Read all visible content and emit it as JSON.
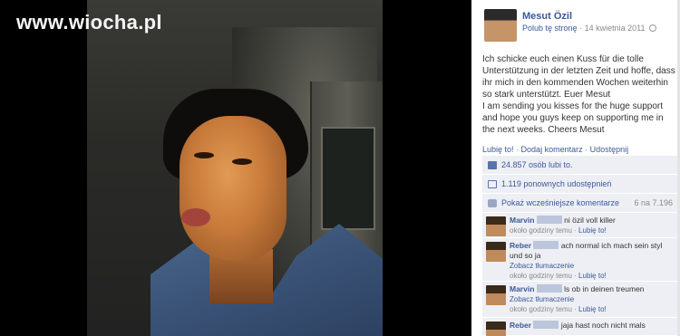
{
  "watermark": "www.wiocha.pl",
  "post": {
    "page_name": "Mesut Özil",
    "like_page": "Polub tę stronę",
    "date": "14 kwietnia 2011",
    "text_de": "Ich schicke euch einen Kuss für die tolle Unterstützung in der letzten Zeit und hoffe, dass ihr mich in den kommenden Wochen weiterhin so stark unterstützt. Euer Mesut",
    "text_en": "I am sending you kisses for the huge support and hope you guys keep on supporting me in the next weeks. Cheers Mesut"
  },
  "actions": {
    "like": "Lubię to!",
    "comment": "Dodaj komentarz",
    "share": "Udostępnij"
  },
  "ufi": {
    "likes": "24.857 osób lubi to.",
    "shares": "1.119 ponownych udostępnień",
    "previous_comments": "Pokaż wcześniejsze komentarze",
    "comment_count": "6 na 7.196"
  },
  "comments": [
    {
      "name": "Marvin",
      "text": "ni özil voll killer",
      "time": "około godziny temu",
      "like": "Lubię to!"
    },
    {
      "name": "Reber",
      "text": "ach normal ich mach sein styl und so ja",
      "translate": "Zobacz tłumaczenie",
      "time": "około godziny temu",
      "like": "Lubię to!"
    },
    {
      "name": "Marvin",
      "text": "ls ob in deinen treumen",
      "translate": "Zobacz tłumaczenie",
      "time": "około godziny temu",
      "like": "Lubię to!"
    },
    {
      "name": "Reber",
      "text": "jaja hast noch nicht mals",
      "time": "",
      "like": ""
    }
  ],
  "colors": {
    "fb_link": "#3b5998",
    "ufi_bg": "#edeff4"
  }
}
